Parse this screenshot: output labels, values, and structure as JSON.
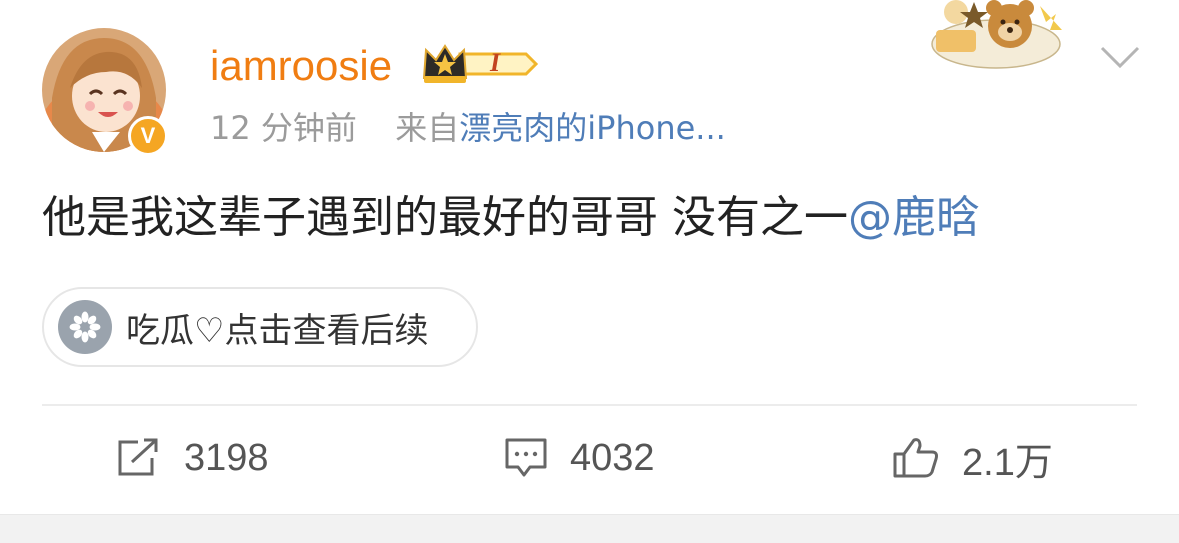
{
  "post": {
    "author": {
      "username": "iamroosie",
      "vip_badge": "I",
      "verified_mark": "V"
    },
    "meta": {
      "time": "12 分钟前",
      "from_prefix": "来自",
      "source": "漂亮肉的iPhone..."
    },
    "text": "他是我这辈子遇到的最好的哥哥 没有之一",
    "mention": "@鹿晗",
    "topic_pill": {
      "label": "吃瓜♡点击查看后续"
    },
    "actions": {
      "repost": "3198",
      "comment": "4032",
      "like": "2.1万"
    }
  },
  "colors": {
    "username": "#f07d12",
    "link": "#4f7db8",
    "meta": "#9b9b9b",
    "text": "#222222",
    "verified": "#f5a623"
  },
  "icons": [
    "chevron-down-icon",
    "repost-icon",
    "comment-icon",
    "like-icon",
    "topic-icon",
    "verified-icon",
    "crown-icon"
  ]
}
